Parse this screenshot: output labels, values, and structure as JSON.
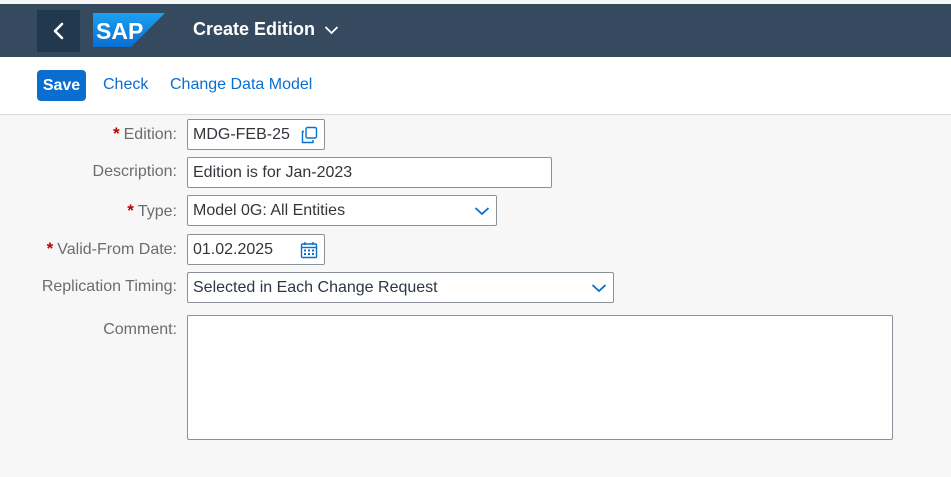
{
  "header": {
    "logo_text": "SAP",
    "title": "Create Edition",
    "back_icon": "chevron-left-icon",
    "title_menu_icon": "chevron-down-icon"
  },
  "toolbar": {
    "save_label": "Save",
    "check_label": "Check",
    "change_model_label": "Change Data Model"
  },
  "form": {
    "edition": {
      "label": "Edition:",
      "value": "MDG-FEB-25",
      "required": true,
      "icon": "copy-icon"
    },
    "description": {
      "label": "Description:",
      "value": "Edition is for Jan-2023",
      "required": false
    },
    "type": {
      "label": "Type:",
      "value": "Model 0G: All Entities",
      "required": true,
      "icon": "chevron-down-icon"
    },
    "valid_from": {
      "label": "Valid-From Date:",
      "value": "01.02.2025",
      "required": true,
      "icon": "calendar-icon"
    },
    "replication": {
      "label": "Replication Timing:",
      "value": "Selected in Each Change Request",
      "required": false,
      "icon": "chevron-down-icon"
    },
    "comment": {
      "label": "Comment:",
      "value": "",
      "required": false
    }
  },
  "colors": {
    "shell": "#354a5f",
    "accent": "#0a6ed1",
    "required": "#bb0000"
  }
}
